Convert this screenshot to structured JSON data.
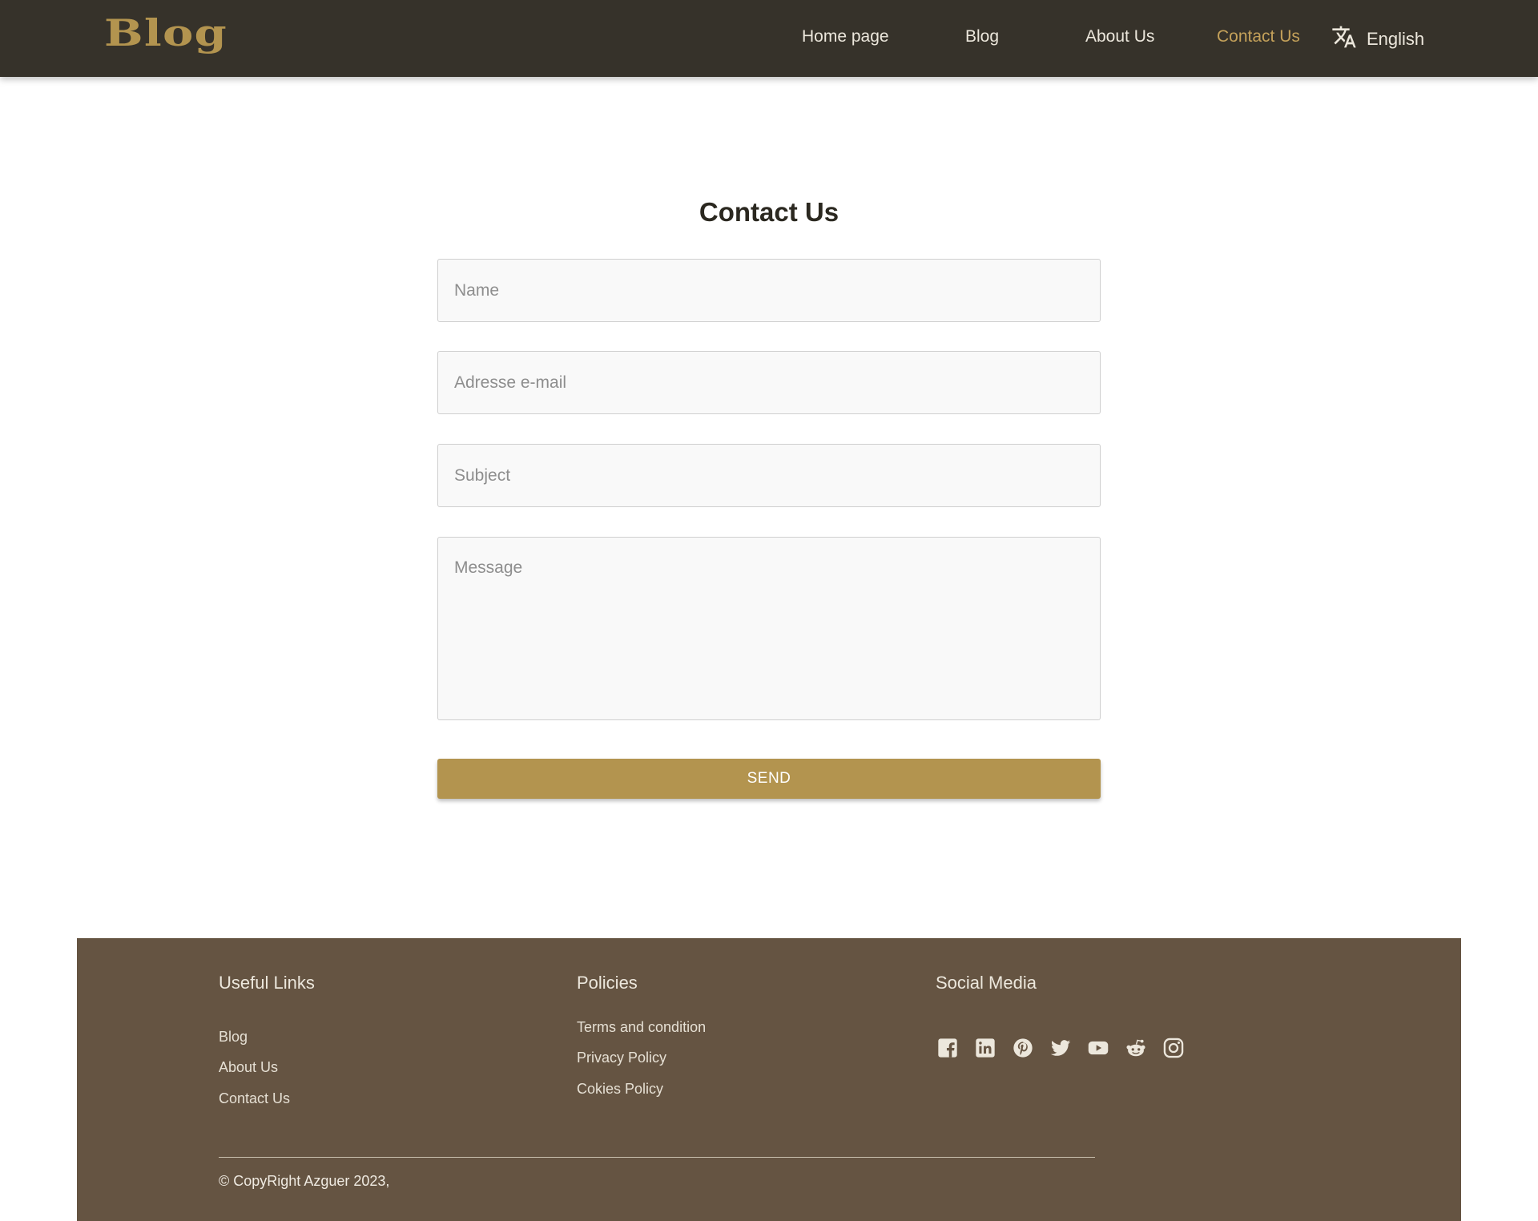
{
  "header": {
    "logo": "Blog",
    "nav": {
      "home": "Home page",
      "blog": "Blog",
      "about": "About Us",
      "contact": "Contact Us"
    },
    "active_item": "Contact Us",
    "language": "English",
    "language_icon": "translate-icon"
  },
  "form": {
    "title": "Contact Us",
    "name_placeholder": "Name",
    "email_placeholder": "Adresse e-mail",
    "subject_placeholder": "Subject",
    "message_placeholder": "Message",
    "send_label": "SEND"
  },
  "footer": {
    "useful_links": {
      "title": "Useful Links",
      "blog": "Blog",
      "about": "About Us",
      "contact": "Contact Us"
    },
    "policies": {
      "title": "Policies",
      "terms": "Terms and condition",
      "privacy": "Privacy Policy",
      "cookies": "Cokies Policy"
    },
    "social": {
      "title": "Social Media",
      "icons": [
        "facebook-icon",
        "linkedin-icon",
        "pinterest-icon",
        "twitter-icon",
        "youtube-icon",
        "reddit-icon",
        "instagram-icon"
      ]
    },
    "copyright": "© CopyRight Azguer 2023,"
  },
  "colors": {
    "header_bg": "#36322a",
    "accent": "#b3944f",
    "footer_bg": "#655442"
  }
}
